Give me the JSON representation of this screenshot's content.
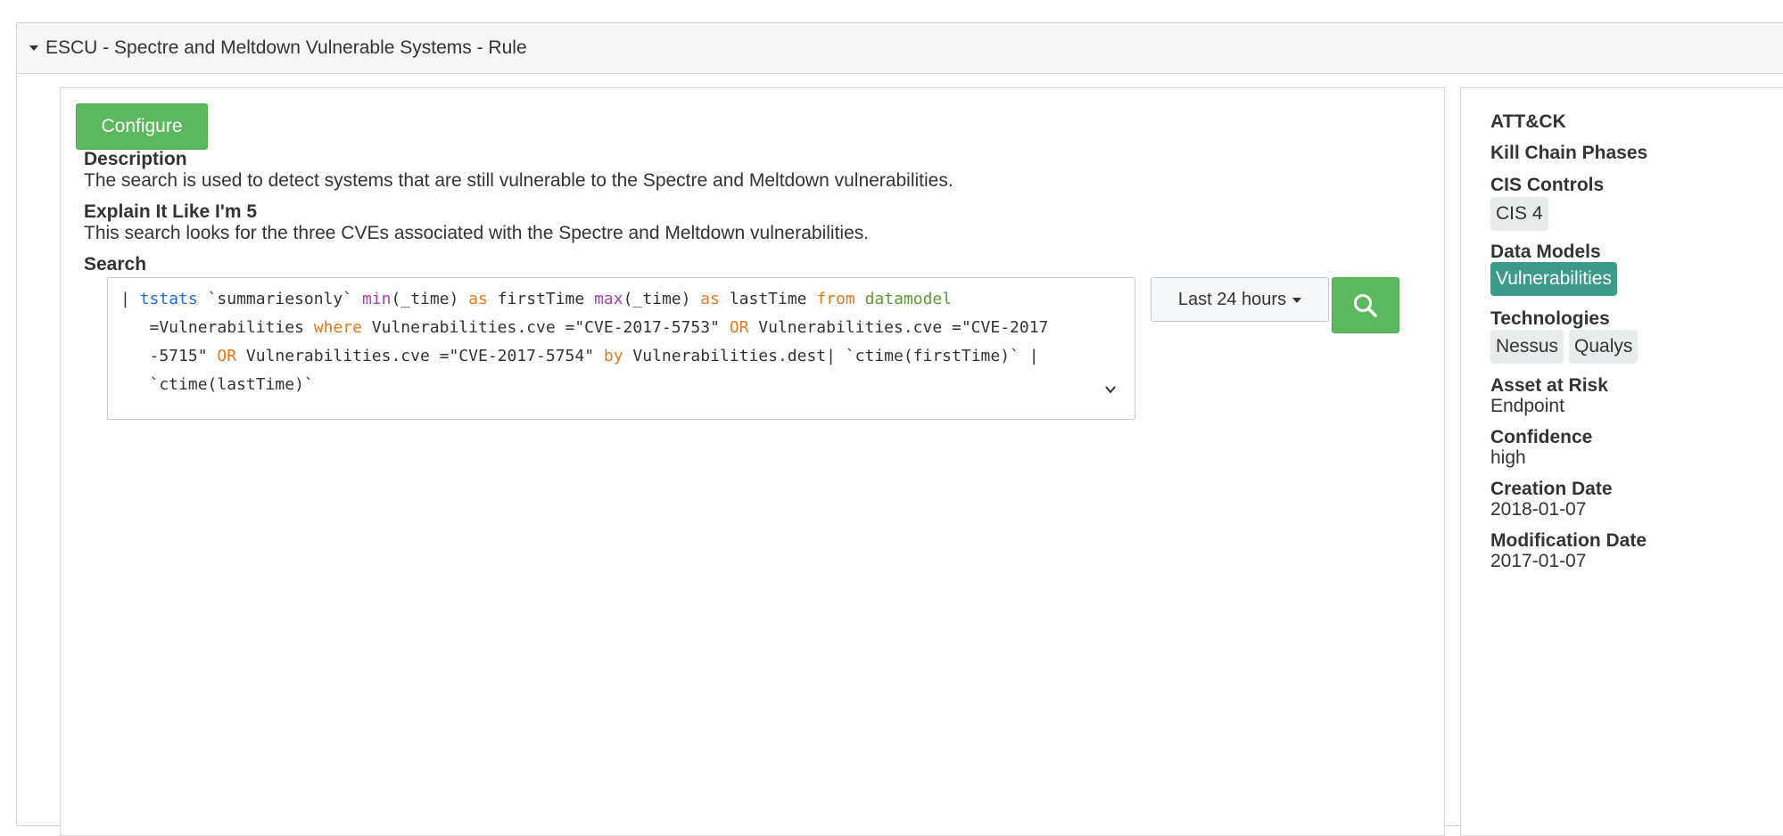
{
  "header": {
    "title": "ESCU - Spectre and Meltdown Vulnerable Systems - Rule"
  },
  "main": {
    "configure_label": "Configure",
    "description": {
      "heading": "Description",
      "text": "The search is used to detect systems that are still vulnerable to the Spectre and Meltdown vulnerabilities."
    },
    "eli5": {
      "heading": "Explain It Like I'm 5",
      "text": "This search looks for the three CVEs associated with the Spectre and Meltdown vulnerabilities."
    },
    "search": {
      "heading": "Search",
      "line1": {
        "pipe": "| ",
        "cmd": "tstats",
        "t1": " `summariesonly` ",
        "fn1": "min",
        "t2": "(_time) ",
        "kw1": "as",
        "t3": " firstTime ",
        "fn2": "max",
        "t4": "(_time) ",
        "kw2": "as",
        "t5": " lastTime ",
        "kw3": "from",
        "t6": " ",
        "dm": "datamodel"
      },
      "line2": {
        "t1": "   =Vulnerabilities ",
        "kw1": "where",
        "t2": " Vulnerabilities.cve =\"CVE-2017-5753\" ",
        "kw2": "OR",
        "t3": " Vulnerabilities.cve =\"CVE-2017"
      },
      "line3": {
        "t1": "   -5715\" ",
        "kw1": "OR",
        "t2": " Vulnerabilities.cve =\"CVE-2017-5754\" ",
        "kw2": "by",
        "t3": " Vulnerabilities.dest| `ctime(firstTime)` |"
      },
      "line4": {
        "t1": "   `ctime(lastTime)`"
      },
      "time_range": "Last 24 hours"
    }
  },
  "sidebar": {
    "attack_label": "ATT&CK",
    "kill_chain_label": "Kill Chain Phases",
    "cis_label": "CIS Controls",
    "cis_tags": [
      "CIS 4"
    ],
    "data_models_label": "Data Models",
    "data_models_tags": [
      "Vulnerabilities"
    ],
    "technologies_label": "Technologies",
    "technologies_tags": [
      "Nessus",
      "Qualys"
    ],
    "asset_label": "Asset at Risk",
    "asset_value": "Endpoint",
    "confidence_label": "Confidence",
    "confidence_value": "high",
    "creation_label": "Creation Date",
    "creation_value": "2018-01-07",
    "modification_label": "Modification Date",
    "modification_value": "2017-01-07"
  },
  "colors": {
    "configure_bg": "#5cb85c",
    "data_model_tag_bg": "#3c9b88",
    "spl_command": "#1a6fd8",
    "spl_function": "#b03cb0",
    "spl_keyword": "#e7781c",
    "spl_datamodel": "#5c9b2e"
  },
  "icons": {
    "header_toggle": "caret-down-icon",
    "expand": "chevron-down-icon",
    "search": "search-icon"
  }
}
